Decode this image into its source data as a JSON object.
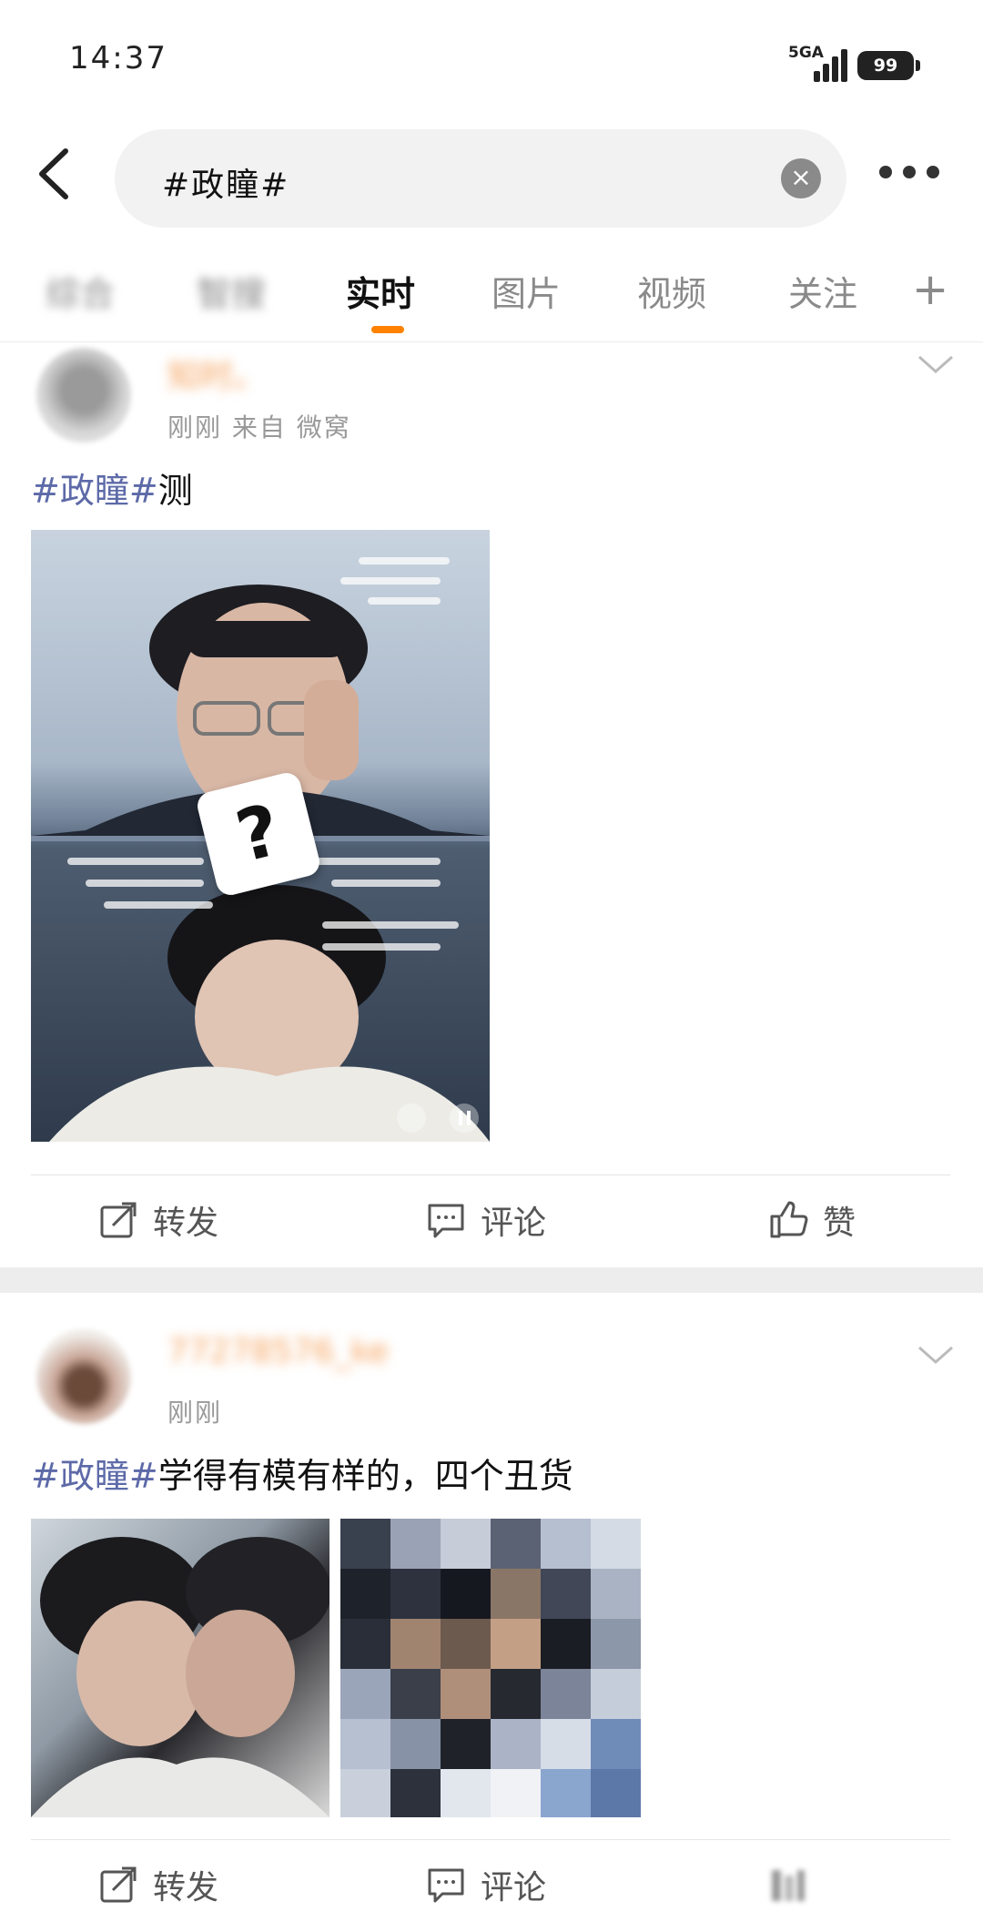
{
  "status_bar": {
    "time": "14:37",
    "network": "5GA",
    "battery": "99"
  },
  "search": {
    "query": "#政瞳#"
  },
  "tabs": [
    {
      "label": "综合"
    },
    {
      "label": "智搜"
    },
    {
      "label": "实时"
    },
    {
      "label": "图片"
    },
    {
      "label": "视频"
    },
    {
      "label": "关注"
    }
  ],
  "posts": [
    {
      "username": "知时。",
      "meta": "刚刚 来自 微窝",
      "tag": "#政瞳#",
      "text": "测",
      "actions": {
        "repost": "转发",
        "comment": "评论",
        "like": "赞"
      }
    },
    {
      "username": "77278576_ke",
      "meta": "刚刚",
      "tag": "#政瞳#",
      "text": "学得有模有样的，四个丑货",
      "actions": {
        "repost": "转发",
        "comment": "评论"
      }
    }
  ],
  "image_overlay": {
    "question_mark": "?"
  },
  "colors": {
    "accent": "#ff8200",
    "tag": "#5d6aa8"
  }
}
